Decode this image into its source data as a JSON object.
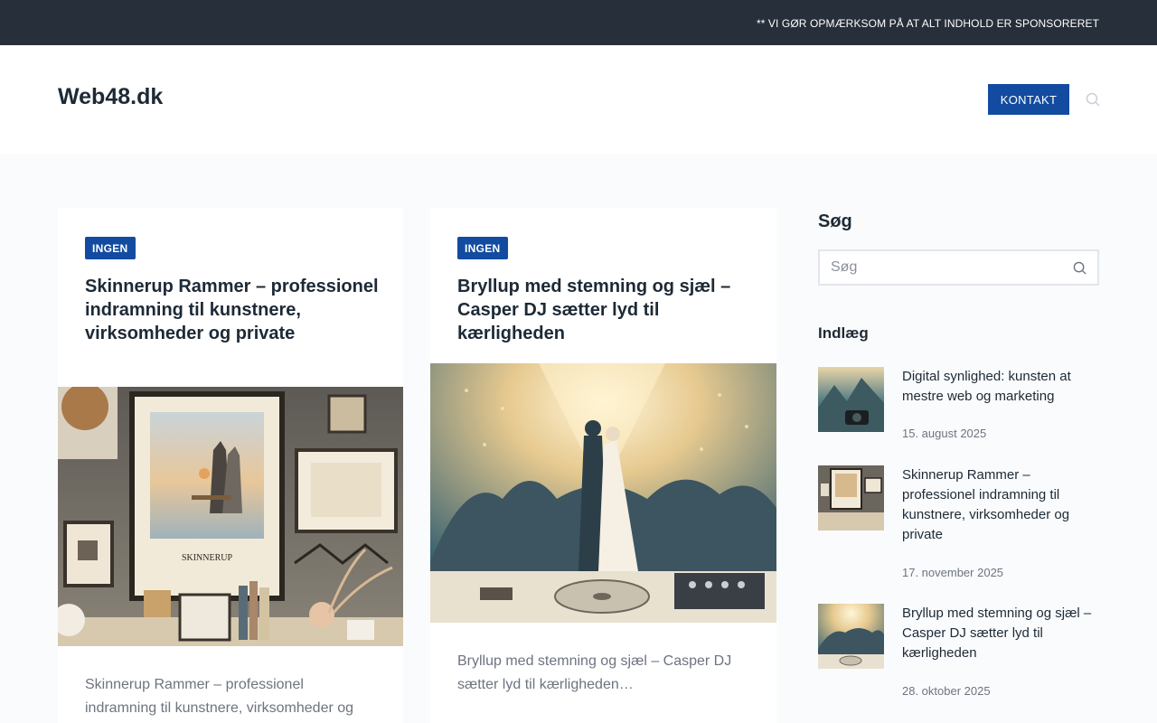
{
  "topbar": {
    "notice": "** VI GØR OPMÆRKSOM PÅ AT ALT INDHOLD ER SPONSORERET"
  },
  "header": {
    "site_title": "Web48.dk",
    "contact_label": "KONTAKT"
  },
  "colors": {
    "topbar_bg": "#262f3a",
    "accent": "#134ba0",
    "page_bg": "#fafbfc"
  },
  "cards": [
    {
      "tag": "INGEN",
      "title": "Skinnerup Rammer – professionel indramning til kunstnere, virksomheder og private",
      "excerpt": "Skinnerup Rammer – professionel indramning til kunstnere, virksomheder og"
    },
    {
      "tag": "INGEN",
      "title": "Bryllup med stemning og sjæl – Casper DJ sætter lyd til kærligheden",
      "excerpt": "Bryllup med stemning og sjæl – Casper DJ sætter lyd til kærligheden…"
    }
  ],
  "sidebar": {
    "search_title": "Søg",
    "search_placeholder": "Søg",
    "posts_title": "Indlæg",
    "posts": [
      {
        "title": "Digital synlighed: kunsten at mestre web og marketing",
        "date": "15. august 2025"
      },
      {
        "title": "Skinnerup Rammer – professionel indramning til kunstnere, virksomheder og private",
        "date": "17. november 2025"
      },
      {
        "title": "Bryllup med stemning og sjæl – Casper DJ sætter lyd til kærligheden",
        "date": "28. oktober 2025"
      }
    ]
  }
}
